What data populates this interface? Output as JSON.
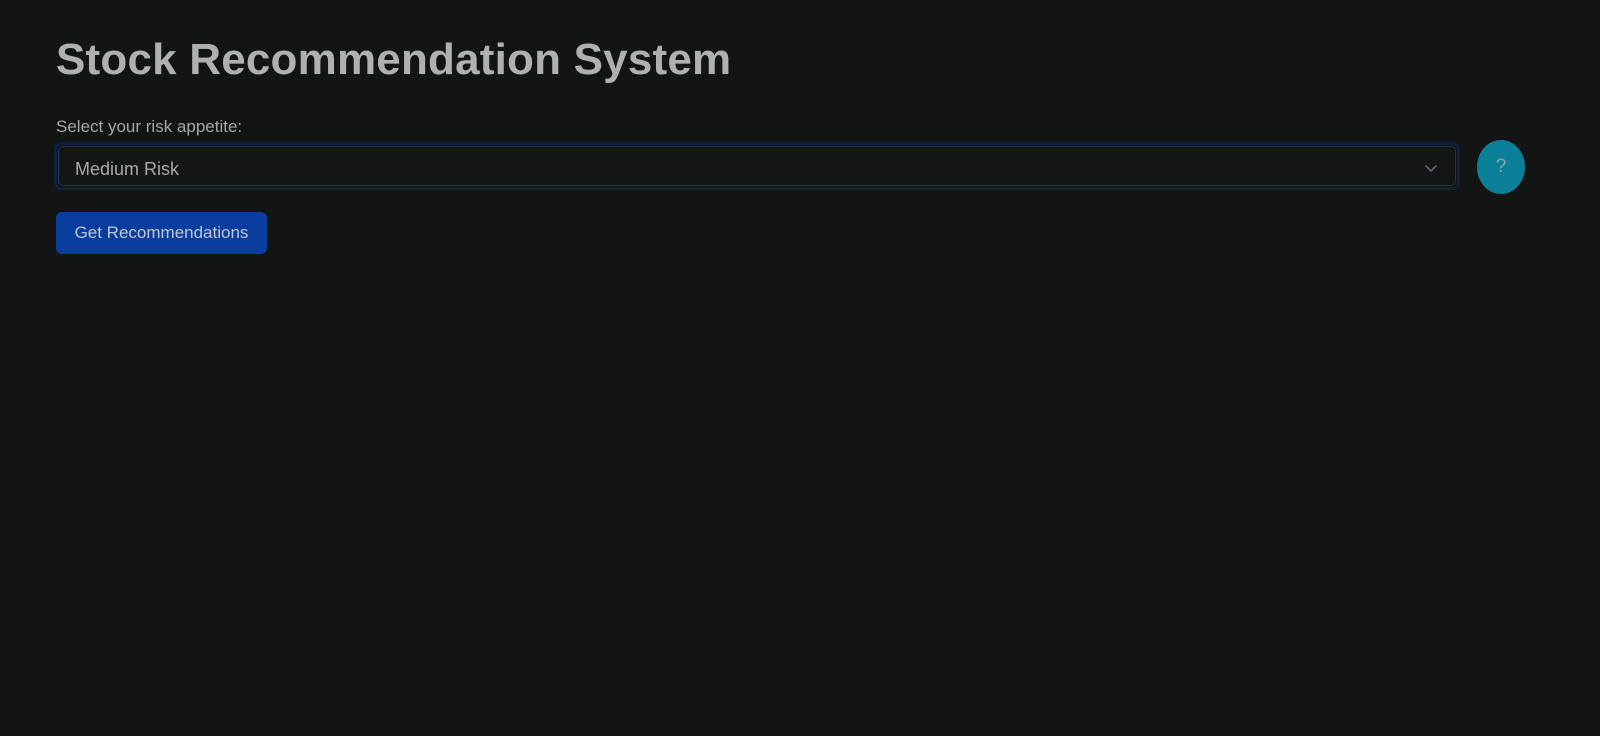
{
  "page": {
    "title": "Stock Recommendation System"
  },
  "form": {
    "risk_label": "Select your risk appetite:",
    "risk_select": {
      "selected": "Medium Risk",
      "icon": "chevron-down-icon"
    },
    "help_button": {
      "label": "?"
    },
    "submit_button": {
      "label": "Get Recommendations"
    }
  },
  "colors": {
    "background": "#131515",
    "primary_button": "#0a3d9e",
    "help_button": "#0b7f97",
    "select_focus_ring": "#0d2140"
  }
}
